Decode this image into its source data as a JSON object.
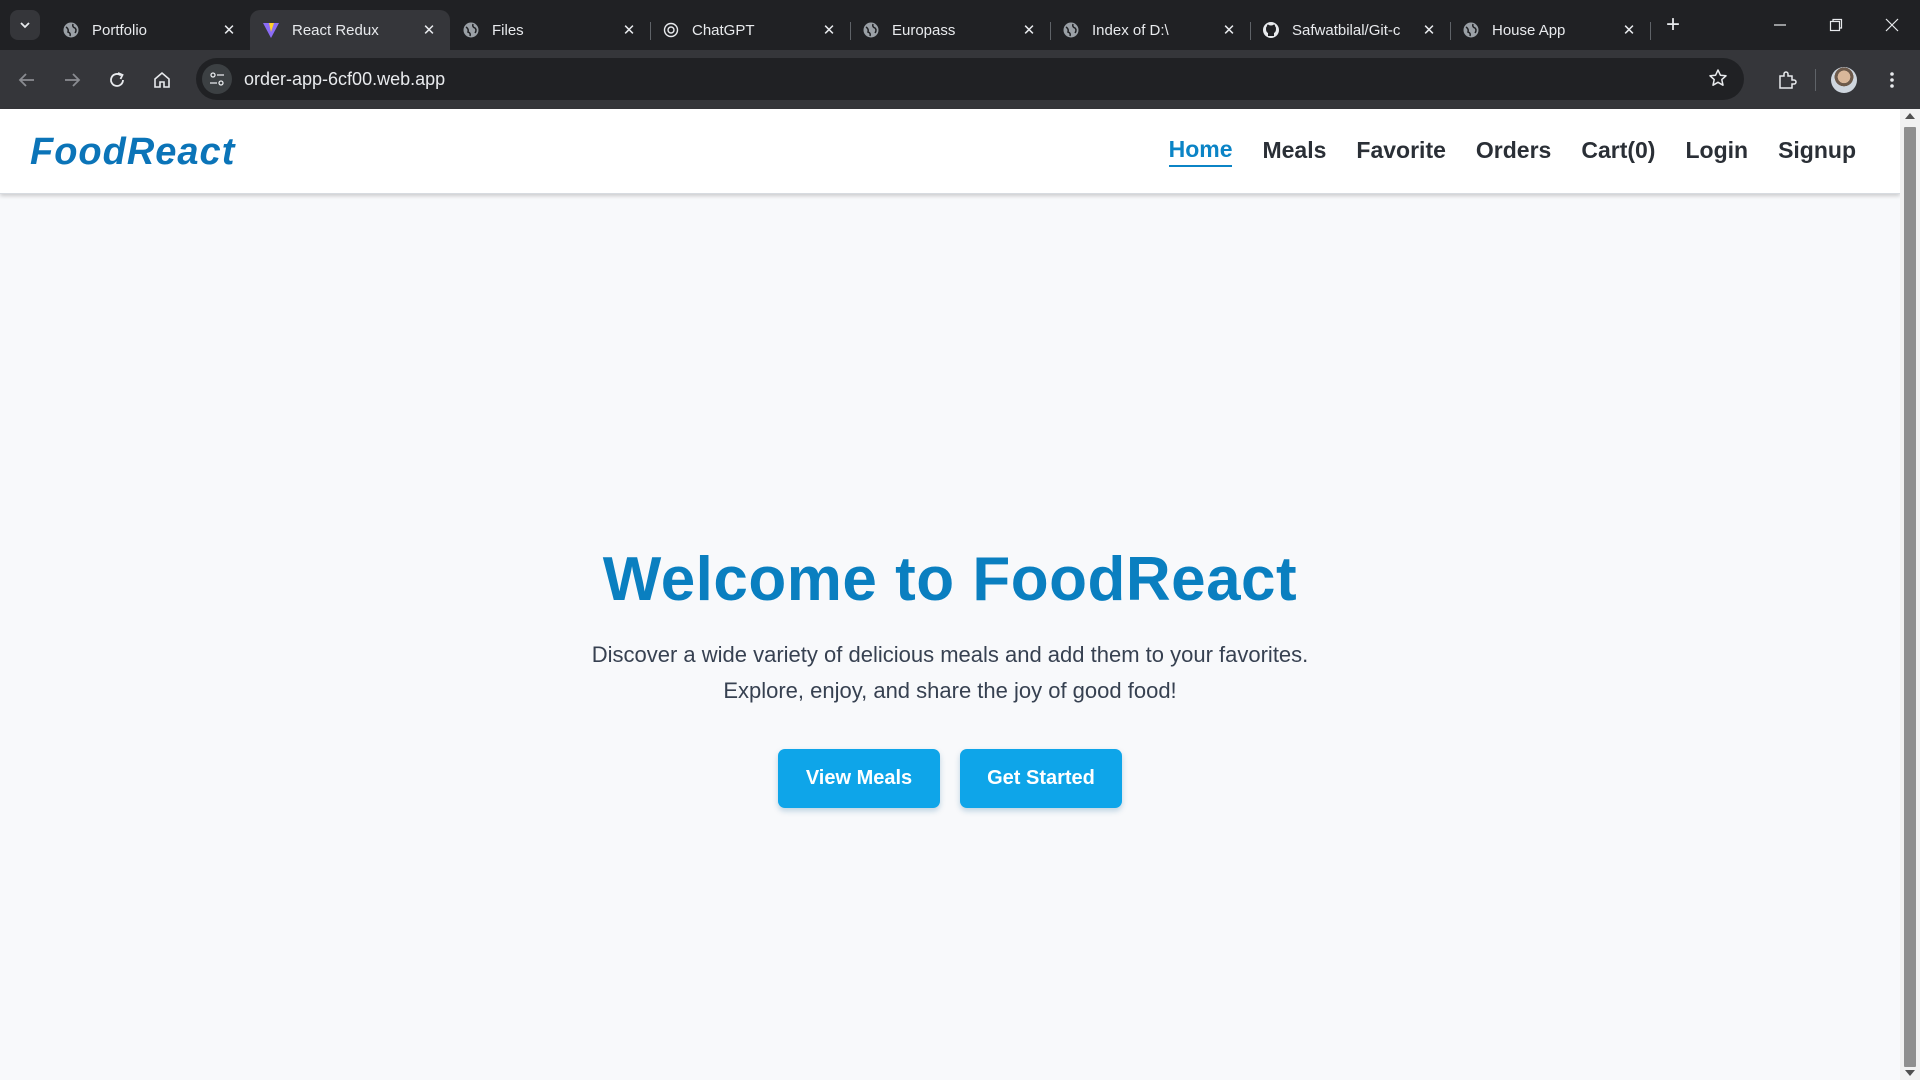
{
  "browser": {
    "tabs": [
      {
        "title": "Portfolio",
        "icon": "globe-icon",
        "active": false
      },
      {
        "title": "React Redux",
        "icon": "vite-icon",
        "active": true
      },
      {
        "title": "Files",
        "icon": "globe-icon",
        "active": false
      },
      {
        "title": "ChatGPT",
        "icon": "chatgpt-icon",
        "active": false
      },
      {
        "title": "Europass",
        "icon": "globe-icon",
        "active": false
      },
      {
        "title": "Index of D:\\",
        "icon": "globe-icon",
        "active": false
      },
      {
        "title": "Safwatbilal/Git-c",
        "icon": "github-icon",
        "active": false
      },
      {
        "title": "House App",
        "icon": "globe-icon",
        "active": false
      }
    ],
    "url": "order-app-6cf00.web.app"
  },
  "site": {
    "logo": "FoodReact",
    "nav": [
      "Home",
      "Meals",
      "Favorite",
      "Orders",
      "Cart(0)",
      "Login",
      "Signup"
    ],
    "active_nav": "Home"
  },
  "hero": {
    "title": "Welcome to FoodReact",
    "line1": "Discover a wide variety of delicious meals and add them to your favorites.",
    "line2": "Explore, enjoy, and share the joy of good food!",
    "primary_button": "View Meals",
    "secondary_button": "Get Started"
  },
  "colors": {
    "brand": "#0b74b8",
    "button": "#0ea5e9",
    "chrome_dark": "#202124"
  }
}
